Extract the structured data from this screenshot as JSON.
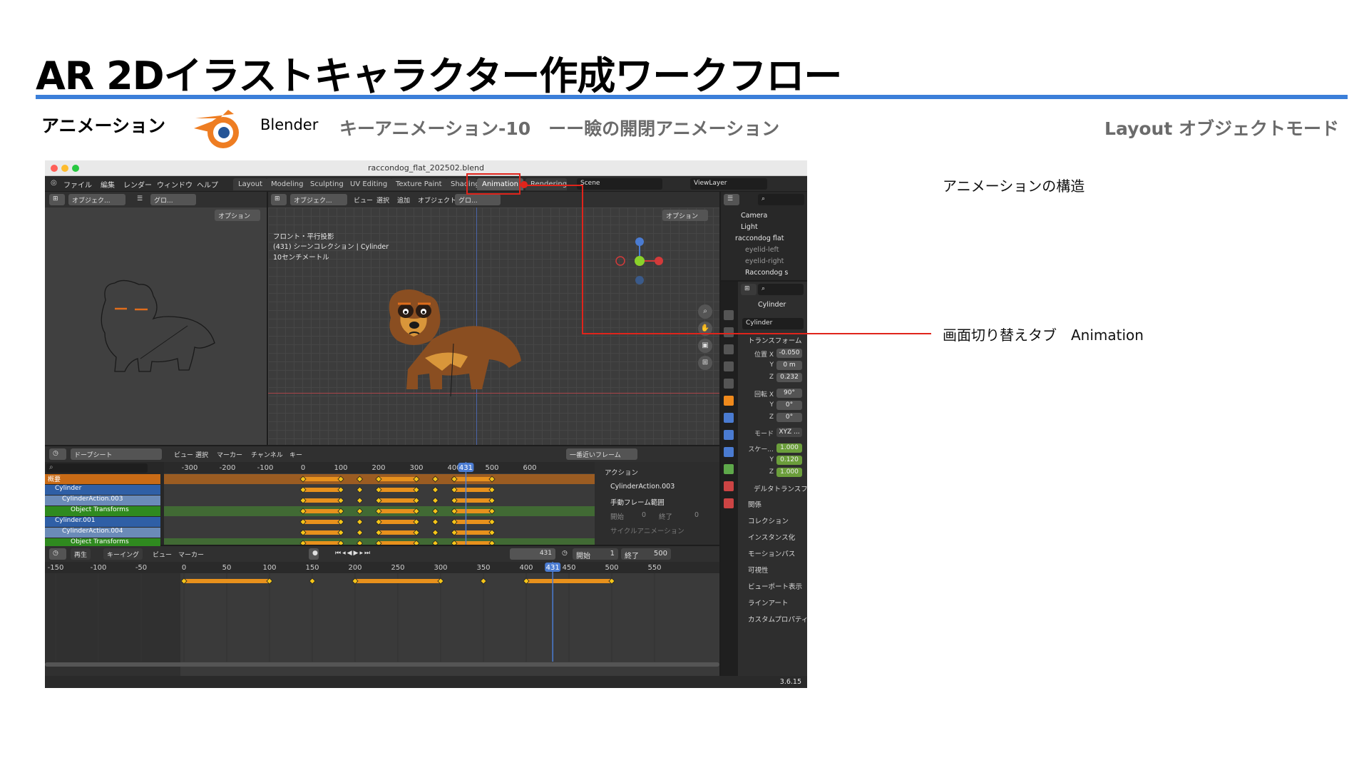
{
  "slide": {
    "title": "AR 2Dイラストキャラクター作成ワークフロー",
    "section": "アニメーション",
    "app_name": "Blender",
    "step": "キーアニメーション-10　ーー瞼の開閉アニメーション",
    "mode": "Layout オブジェクトモード"
  },
  "annotations": {
    "structure": "アニメーションの構造",
    "tab_switch": "画面切り替えタブ　Animation"
  },
  "blender": {
    "filename": "raccondog_flat_202502.blend",
    "menus": [
      "ファイル",
      "編集",
      "レンダー",
      "ウィンドウ",
      "ヘルプ"
    ],
    "workspaces": [
      "Layout",
      "Modeling",
      "Sculpting",
      "UV Editing",
      "Texture Paint",
      "Shading",
      "Animation",
      "Rendering"
    ],
    "active_workspace": "Animation",
    "scene": "Scene",
    "view_layer": "ViewLayer",
    "left_header": {
      "mode": "オブジェク...",
      "global": "グロ...",
      "options": "オプション"
    },
    "main_header": {
      "mode": "オブジェク...",
      "menus": [
        "ビュー",
        "選択",
        "追加",
        "オブジェクト"
      ],
      "global": "グロ...",
      "options": "オプション"
    },
    "viewport_info": [
      "フロント・平行投影",
      "(431) シーンコレクション | Cylinder",
      "10センチメートル"
    ],
    "outliner": [
      {
        "label": "Camera"
      },
      {
        "label": "Light"
      },
      {
        "label": "raccondog flat"
      },
      {
        "label": "eyelid-left"
      },
      {
        "label": "eyelid-right"
      },
      {
        "label": "Raccondog s"
      }
    ],
    "properties": {
      "object_name": "Cylinder",
      "datablock": "Cylinder",
      "transform_label": "トランスフォーム",
      "location_label": "位置 X",
      "rotation_label": "回転 X",
      "mode_label": "モード",
      "scale_label": "スケー...",
      "y_label": "Y",
      "z_label": "Z",
      "location": [
        "-0.050",
        "0 m",
        "0.232"
      ],
      "rotation": [
        "90°",
        "0°",
        "0°"
      ],
      "rotation_mode": "XYZ ...",
      "scale": [
        "1.000",
        "0.120",
        "1.000"
      ],
      "delta": "デルタトランスフォーム",
      "sections": [
        "関係",
        "コレクション",
        "インスタンス化",
        "モーションパス",
        "可視性",
        "ビューポート表示",
        "ラインアート",
        "カスタムプロパティ"
      ]
    },
    "dopesheet": {
      "mode": "ドープシート",
      "menus": [
        "ビュー",
        "選択",
        "マーカー",
        "チャンネル",
        "キー"
      ],
      "snap": "一番近いフレーム",
      "ticks": [
        "-300",
        "-200",
        "-100",
        "0",
        "100",
        "200",
        "300",
        "400",
        "500",
        "600"
      ],
      "current_frame": "431",
      "channels": [
        {
          "label": "概要"
        },
        {
          "label": "Cylinder"
        },
        {
          "label": "CylinderAction.003"
        },
        {
          "label": "Object Transforms"
        },
        {
          "label": "Cylinder.001"
        },
        {
          "label": "CylinderAction.004"
        },
        {
          "label": "Object Transforms"
        }
      ],
      "side_title": "アクション",
      "side_action": "CylinderAction.003",
      "manual_range": "手動フレーム範囲",
      "start": "開始",
      "start_val": "0",
      "end": "終了",
      "end_val": "0",
      "cyclic": "サイクルアニメーション"
    },
    "timeline": {
      "menus": [
        "再生",
        "キーイング",
        "ビュー",
        "マーカー"
      ],
      "frame": "431",
      "start_label": "開始",
      "start": "1",
      "end_label": "終了",
      "end": "500",
      "ticks": [
        "-150",
        "-100",
        "-50",
        "0",
        "50",
        "100",
        "150",
        "200",
        "250",
        "300",
        "350",
        "400",
        "450",
        "500",
        "550"
      ],
      "current": "431"
    },
    "version": "3.6.15"
  }
}
